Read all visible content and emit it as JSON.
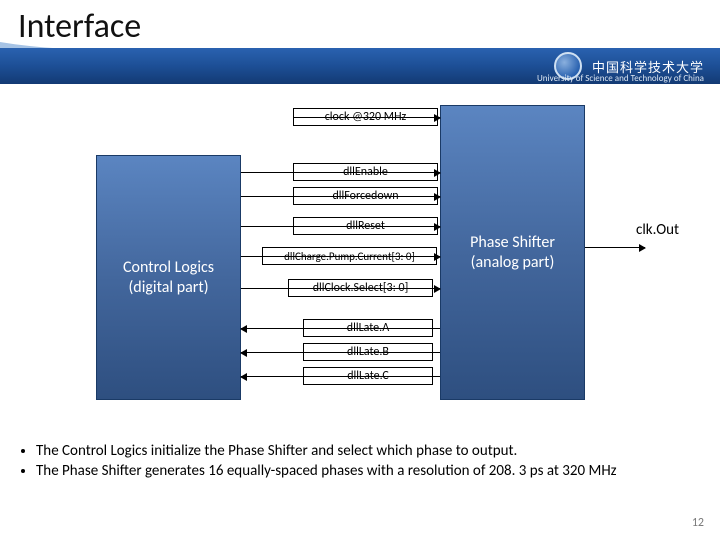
{
  "header": {
    "title": "Interface",
    "university": "University of Science and Technology of China"
  },
  "blocks": {
    "control": "Control Logics\n(digital part)",
    "shifter": "Phase Shifter\n(analog part)"
  },
  "signals": {
    "clock": "clock @320 MHz",
    "enable": "dllEnable",
    "forcedown": "dllForcedown",
    "reset": "dllReset",
    "chargepump": "dllCharge.Pump.Current[3: 0]",
    "clocksel": "dllClock.Select[3: 0]",
    "lateA": "dllLate.A",
    "lateB": "dllLate.B",
    "lateC": "dllLate.C"
  },
  "clk_out": "clk.Out",
  "bullets": [
    "The Control Logics initialize the Phase Shifter and select which phase to output.",
    "The Phase Shifter generates 16 equally-spaced phases with a resolution of 208. 3 ps at 320 MHz"
  ],
  "page_number": "12",
  "chart_data": {
    "type": "diagram",
    "nodes": [
      {
        "id": "control",
        "label": "Control Logics (digital part)"
      },
      {
        "id": "shifter",
        "label": "Phase Shifter (analog part)"
      }
    ],
    "edges": [
      {
        "from": "external",
        "to": "shifter",
        "label": "clock @320 MHz",
        "dir": "r"
      },
      {
        "from": "control",
        "to": "shifter",
        "label": "dllEnable",
        "dir": "r"
      },
      {
        "from": "control",
        "to": "shifter",
        "label": "dllForcedown",
        "dir": "r"
      },
      {
        "from": "control",
        "to": "shifter",
        "label": "dllReset",
        "dir": "r"
      },
      {
        "from": "control",
        "to": "shifter",
        "label": "dllCharge.Pump.Current[3:0]",
        "dir": "r"
      },
      {
        "from": "control",
        "to": "shifter",
        "label": "dllClock.Select[3:0]",
        "dir": "r"
      },
      {
        "from": "shifter",
        "to": "control",
        "label": "dllLate.A",
        "dir": "l"
      },
      {
        "from": "shifter",
        "to": "control",
        "label": "dllLate.B",
        "dir": "l"
      },
      {
        "from": "shifter",
        "to": "control",
        "label": "dllLate.C",
        "dir": "l"
      },
      {
        "from": "shifter",
        "to": "external",
        "label": "clk.Out",
        "dir": "r"
      }
    ]
  }
}
